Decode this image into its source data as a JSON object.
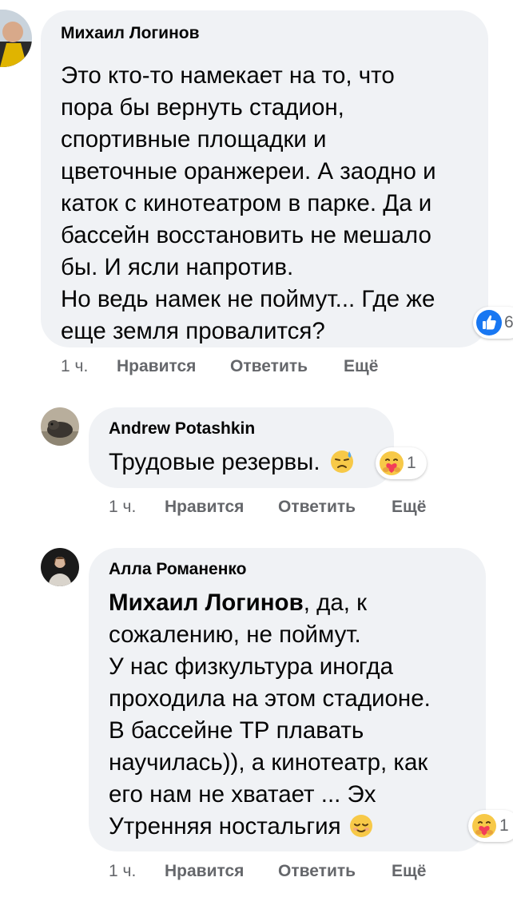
{
  "colors": {
    "bubble_bg": "#f0f2f5",
    "meta_text": "#65676b",
    "like_blue": "#1877f2",
    "emoji_yellow": "#f7c948"
  },
  "comments": [
    {
      "author": "Михаил Логинов",
      "lines": [
        "Это кто-то намекает на то, что",
        "пора бы вернуть стадион,",
        "спортивные площадки и",
        "цветочные оранжереи. А заодно и",
        "каток с кинотеатром в парке. Да и",
        "бассейн восстановить не мешало",
        "бы. И ясли напротив.",
        "Но ведь намек не поймут... Где же",
        "еще земля провалится?"
      ],
      "time": "1 ч.",
      "like": "Нравится",
      "reply": "Ответить",
      "more": "Ещё",
      "reaction_icon": "like-icon",
      "reaction_count": "6"
    },
    {
      "author": "Andrew Potashkin",
      "text": "Трудовые резервы.",
      "inline_emoji": "downcast-sweat-emoji",
      "time": "1 ч.",
      "like": "Нравится",
      "reply": "Ответить",
      "more": "Ещё",
      "reaction_icon": "care-hug-icon",
      "reaction_count": "1"
    },
    {
      "author": "Алла Романенко",
      "mention": "Михаил Логинов",
      "first_line_rest": ", да, к",
      "lines": [
        "сожалению, не поймут.",
        "У нас физкультура иногда",
        "проходила на этом стадионе.",
        "В бассейне ТР плавать",
        "научилась)), а кинотеатр, как",
        "его нам не хватает ... Эх",
        "Утренняя ностальгия"
      ],
      "inline_emoji": "relieved-face-emoji",
      "time": "1 ч.",
      "like": "Нравится",
      "reply": "Ответить",
      "more": "Ещё",
      "reaction_icon": "care-hug-icon",
      "reaction_count": "1"
    }
  ]
}
